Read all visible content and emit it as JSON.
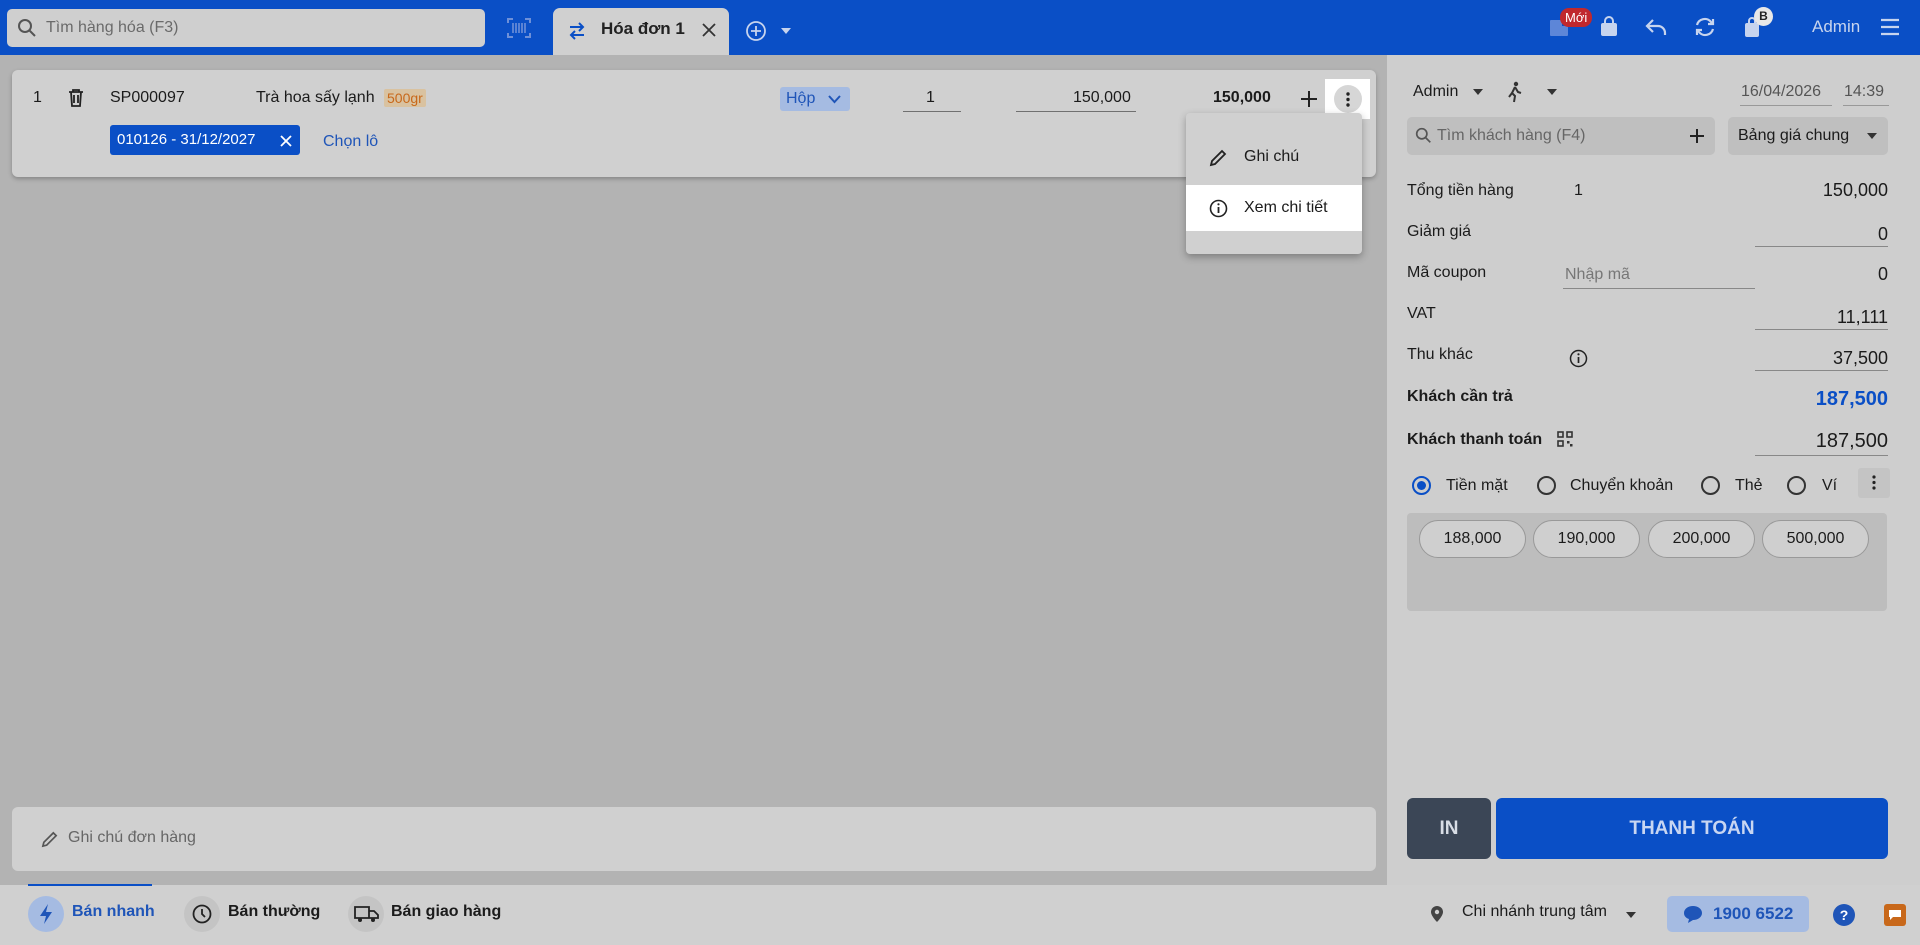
{
  "topbar": {
    "search_placeholder": "Tìm hàng hóa (F3)",
    "tab_label": "Hóa đơn 1",
    "badge_new": "Mới",
    "badge_b": "B",
    "user": "Admin"
  },
  "product_row": {
    "index": "1",
    "code": "SP000097",
    "name": "Trà hoa sấy lạnh",
    "variant": "500gr",
    "unit": "Hộp",
    "quantity": "1",
    "price": "150,000",
    "total": "150,000",
    "lot": "010126 - 31/12/2027",
    "choose_lot": "Chọn lô"
  },
  "context_menu": {
    "items": [
      {
        "label": "Ghi chú",
        "icon": "pencil-icon"
      },
      {
        "label": "Xem chi tiết",
        "icon": "info-icon"
      }
    ]
  },
  "order_note_placeholder": "Ghi chú đơn hàng",
  "right_panel": {
    "seller": "Admin",
    "date": "16/04/2026",
    "time": "14:39",
    "customer_search_placeholder": "Tìm khách hàng (F4)",
    "price_book": "Bảng giá chung",
    "subtotal_label": "Tổng tiền hàng",
    "subtotal_qty": "1",
    "subtotal_value": "150,000",
    "discount_label": "Giảm giá",
    "discount_value": "0",
    "coupon_label": "Mã coupon",
    "coupon_placeholder": "Nhập mã",
    "coupon_value": "0",
    "vat_label": "VAT",
    "vat_value": "11,111",
    "other_label": "Thu khác",
    "other_value": "37,500",
    "due_label": "Khách cần trả",
    "due_value": "187,500",
    "paid_label": "Khách thanh toán",
    "paid_value": "187,500",
    "payment_methods": [
      "Tiền mặt",
      "Chuyển khoản",
      "Thẻ",
      "Ví"
    ],
    "selected_method": "Tiền mặt",
    "quick_amounts": [
      "188,000",
      "190,000",
      "200,000",
      "500,000"
    ],
    "print_label": "IN",
    "pay_label": "THANH TOÁN"
  },
  "bottombar": {
    "modes": [
      "Bán nhanh",
      "Bán thường",
      "Bán giao hàng"
    ],
    "active_mode": "Bán nhanh",
    "branch": "Chi nhánh trung tâm",
    "hotline": "1900 6522"
  },
  "colors": {
    "brand_blue": "#0a4fc6",
    "accent_text_blue": "#1f55b8",
    "dark_button": "#3b4656",
    "badge_red": "#c0282d",
    "variant_orange": "#c8681a"
  }
}
